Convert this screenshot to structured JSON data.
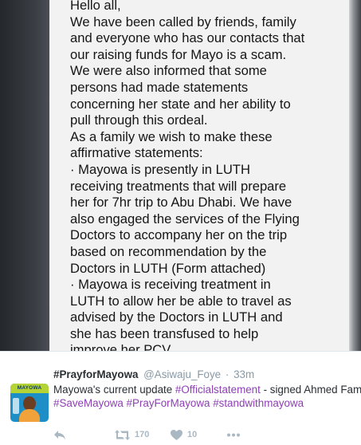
{
  "photo": {
    "letter_lines": [
      "Hello all,",
      "We have been called by friends, family",
      "and everyone who has our contacts that",
      "our raising funds for Mayo is a scam.",
      "We were also informed that some",
      "persons had made statements",
      "concerning her state and her ability to",
      "pull through this ordeal.",
      "As a family we wish to make these",
      "affirmative statements:",
      "·       Mayowa is presently in LUTH",
      "receiving treatments that will prepare",
      "her for 7hr trip to Abu Dhabi. We have",
      "also engaged the services of the Flying",
      "Doctors to accompany her on the trip",
      "based on recommendation by the",
      "Doctors in LUTH (Form attached)",
      "·       Mayowa is receiving treatment in",
      "LUTH to allow her be able to travel as",
      "advised by the Doctors in LUTH and",
      "she has been transfused to help",
      "improve her PCV"
    ]
  },
  "tweet": {
    "avatar_text": "MAYOWA",
    "display_name": "#PrayforMayowa",
    "handle": "@Asiwaju_Foye",
    "separator": "·",
    "timestamp": "33m",
    "text_line1_plain": "Mayowa's current update ",
    "text_line1_hashtag": "#Officialstatement",
    "text_line1_rest": " - signed Ahmed Family",
    "text_line2_hashtags": "#SaveMayowa #PrayForMayowa #standwithmayowa",
    "hashtag_color": "#8e3fb5",
    "retweet_count": "170",
    "like_count": "10"
  },
  "icons": {
    "reply": "reply-icon",
    "retweet": "retweet-icon",
    "like": "heart-icon",
    "more": "more-dots-icon"
  }
}
